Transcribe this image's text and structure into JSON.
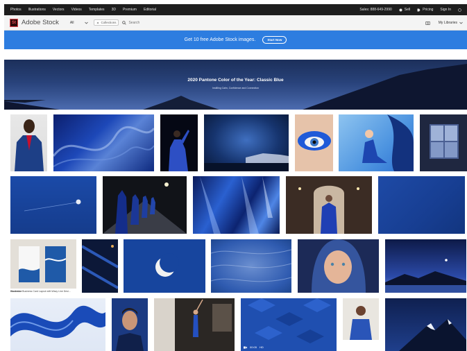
{
  "topnav": {
    "links": [
      "Photos",
      "Illustrations",
      "Vectors",
      "Videos",
      "Templates",
      "3D",
      "Premium",
      "Editorial"
    ],
    "sales": "Sales: 888-649-2990",
    "sell": "Sell",
    "pricing": "Pricing",
    "signin": "Sign In"
  },
  "header": {
    "logo": "St",
    "brand": "Adobe Stock",
    "filter": "All",
    "collections": "Collections",
    "search_placeholder": "Search",
    "libraries": "My Libraries"
  },
  "promo": {
    "text": "Get 10 free Adobe Stock images.",
    "button": "Start Now"
  },
  "hero": {
    "title": "2020 Pantone Color of the Year: Classic Blue",
    "subtitle": "Instilling Calm, Confidence and Connection"
  },
  "tiles": {
    "illustrator_badge": "Illustrator",
    "illustrator_caption": "Business Card Layout with Wavy Line Desi...",
    "video_duration": "00:05",
    "video_quality": "HD"
  },
  "colors": {
    "classic_blue": "#0f4c81",
    "promo_blue": "#2d7de0",
    "nav_dark": "#1e1e1e"
  }
}
